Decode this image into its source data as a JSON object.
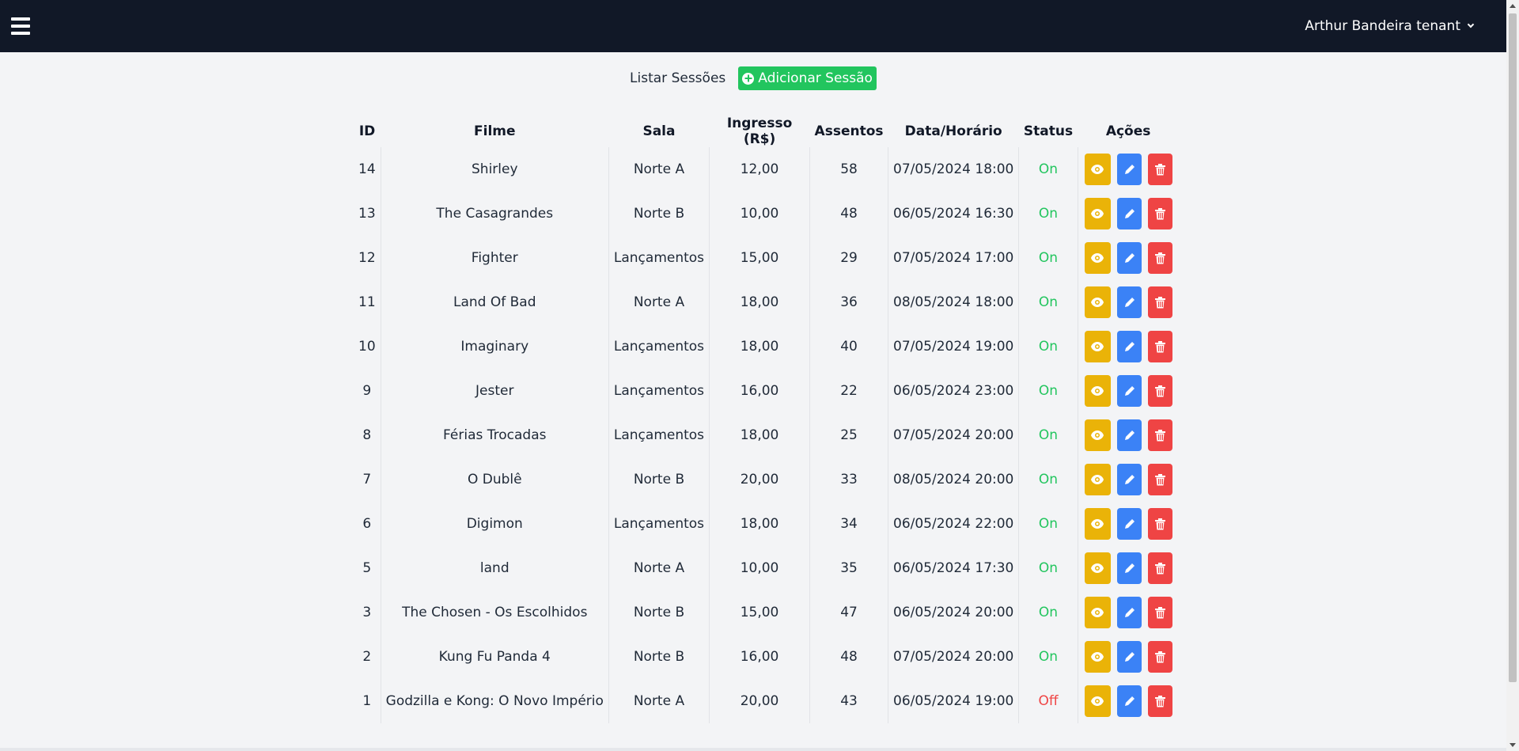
{
  "navbar": {
    "menu_icon": "hamburger-icon",
    "user_name": "Arthur Bandeira tenant",
    "dropdown_icon": "chevron-down-icon"
  },
  "toolbar": {
    "title": "Listar Sessões",
    "add_label": "Adicionar Sessão",
    "add_icon": "plus-circle-icon"
  },
  "colors": {
    "navbar_bg": "#111827",
    "add_button": "#22c55e",
    "view_button": "#eab308",
    "edit_button": "#3b82f6",
    "delete_button": "#ef4444",
    "status_on": "#22c55e",
    "status_off": "#ef4444"
  },
  "table": {
    "headers": [
      "ID",
      "Filme",
      "Sala",
      "Ingresso (R$)",
      "Assentos",
      "Data/Horário",
      "Status",
      "Ações"
    ],
    "action_icons": [
      "eye-icon",
      "pencil-icon",
      "trash-icon"
    ],
    "rows": [
      {
        "id": "14",
        "filme": "Shirley",
        "sala": "Norte A",
        "ingresso": "12,00",
        "assentos": "58",
        "data": "07/05/2024 18:00",
        "status": "On"
      },
      {
        "id": "13",
        "filme": "The Casagrandes",
        "sala": "Norte B",
        "ingresso": "10,00",
        "assentos": "48",
        "data": "06/05/2024 16:30",
        "status": "On"
      },
      {
        "id": "12",
        "filme": "Fighter",
        "sala": "Lançamentos",
        "ingresso": "15,00",
        "assentos": "29",
        "data": "07/05/2024 17:00",
        "status": "On"
      },
      {
        "id": "11",
        "filme": "Land Of Bad",
        "sala": "Norte A",
        "ingresso": "18,00",
        "assentos": "36",
        "data": "08/05/2024 18:00",
        "status": "On"
      },
      {
        "id": "10",
        "filme": "Imaginary",
        "sala": "Lançamentos",
        "ingresso": "18,00",
        "assentos": "40",
        "data": "07/05/2024 19:00",
        "status": "On"
      },
      {
        "id": "9",
        "filme": "Jester",
        "sala": "Lançamentos",
        "ingresso": "16,00",
        "assentos": "22",
        "data": "06/05/2024 23:00",
        "status": "On"
      },
      {
        "id": "8",
        "filme": "Férias Trocadas",
        "sala": "Lançamentos",
        "ingresso": "18,00",
        "assentos": "25",
        "data": "07/05/2024 20:00",
        "status": "On"
      },
      {
        "id": "7",
        "filme": "O Dublê",
        "sala": "Norte B",
        "ingresso": "20,00",
        "assentos": "33",
        "data": "08/05/2024 20:00",
        "status": "On"
      },
      {
        "id": "6",
        "filme": "Digimon",
        "sala": "Lançamentos",
        "ingresso": "18,00",
        "assentos": "34",
        "data": "06/05/2024 22:00",
        "status": "On"
      },
      {
        "id": "5",
        "filme": "land",
        "sala": "Norte A",
        "ingresso": "10,00",
        "assentos": "35",
        "data": "06/05/2024 17:30",
        "status": "On"
      },
      {
        "id": "3",
        "filme": "The Chosen - Os Escolhidos",
        "sala": "Norte B",
        "ingresso": "15,00",
        "assentos": "47",
        "data": "06/05/2024 20:00",
        "status": "On"
      },
      {
        "id": "2",
        "filme": "Kung Fu Panda 4",
        "sala": "Norte B",
        "ingresso": "16,00",
        "assentos": "48",
        "data": "07/05/2024 20:00",
        "status": "On"
      },
      {
        "id": "1",
        "filme": "Godzilla e Kong: O Novo Império",
        "sala": "Norte A",
        "ingresso": "20,00",
        "assentos": "43",
        "data": "06/05/2024 19:00",
        "status": "Off"
      }
    ]
  }
}
